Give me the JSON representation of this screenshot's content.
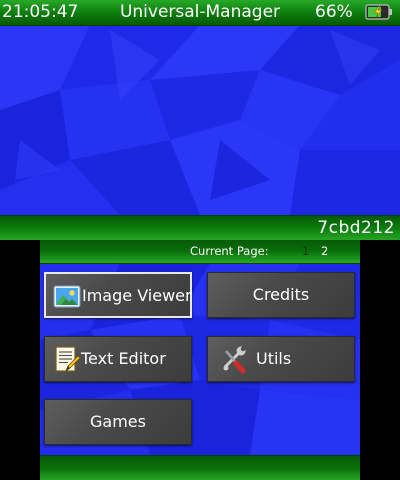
{
  "top": {
    "status_bar": {
      "time": "21:05:47",
      "title": "Universal-Manager",
      "battery_percent": "66%",
      "battery_icon": "battery-charging-icon"
    },
    "footer": {
      "commit": "7cbd212"
    }
  },
  "bottom": {
    "pagination": {
      "label": "Current Page:",
      "pages": [
        "1",
        "2"
      ],
      "current_page": "1"
    },
    "menu": [
      {
        "label": "Image Viewer",
        "icon": "image-icon",
        "selected": true
      },
      {
        "label": "Credits",
        "icon": "",
        "selected": false
      },
      {
        "label": "Text Editor",
        "icon": "text-document-icon",
        "selected": false
      },
      {
        "label": "Utils",
        "icon": "tools-icon",
        "selected": false
      },
      {
        "label": "Games",
        "icon": "",
        "selected": false
      }
    ]
  },
  "colors": {
    "accent_green": "#0c7a0c",
    "background_blue": "#1a24e0",
    "button_gray": "#4a4a4a"
  }
}
